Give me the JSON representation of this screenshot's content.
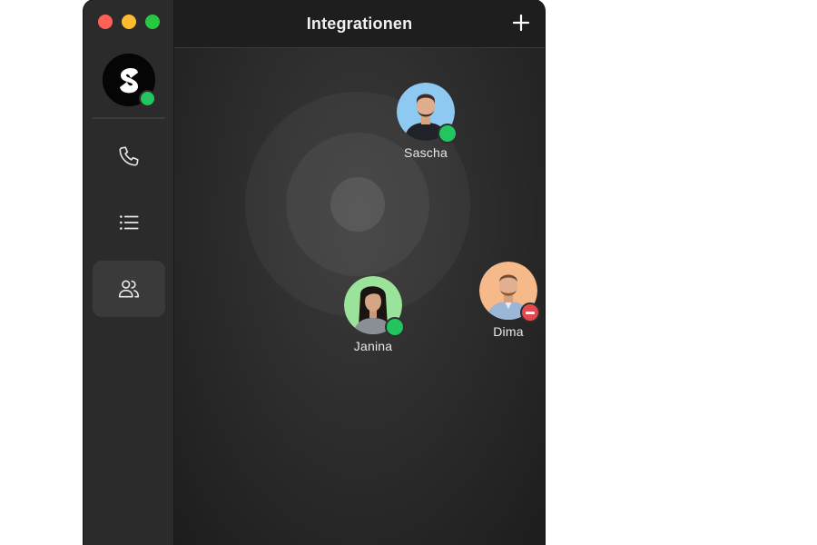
{
  "window": {
    "title": "Integrationen"
  },
  "sidebar": {
    "profile": {
      "status": "online"
    },
    "items": [
      {
        "icon": "phone-icon",
        "active": false
      },
      {
        "icon": "list-icon",
        "active": false
      },
      {
        "icon": "users-icon",
        "active": true
      }
    ]
  },
  "header": {
    "title": "Integrationen",
    "add_icon": "plus-icon"
  },
  "contacts": [
    {
      "name": "Sascha",
      "status": "online",
      "avatar_bg": "#8ec9f2"
    },
    {
      "name": "Janina",
      "status": "online",
      "avatar_bg": "#9be39a"
    },
    {
      "name": "Dima",
      "status": "do-not-disturb",
      "avatar_bg": "#f5b98a"
    }
  ],
  "colors": {
    "online": "#22c55e",
    "dnd": "#e5484d",
    "traffic_close": "#fe5f57",
    "traffic_min": "#febc2e",
    "traffic_max": "#28c840"
  }
}
